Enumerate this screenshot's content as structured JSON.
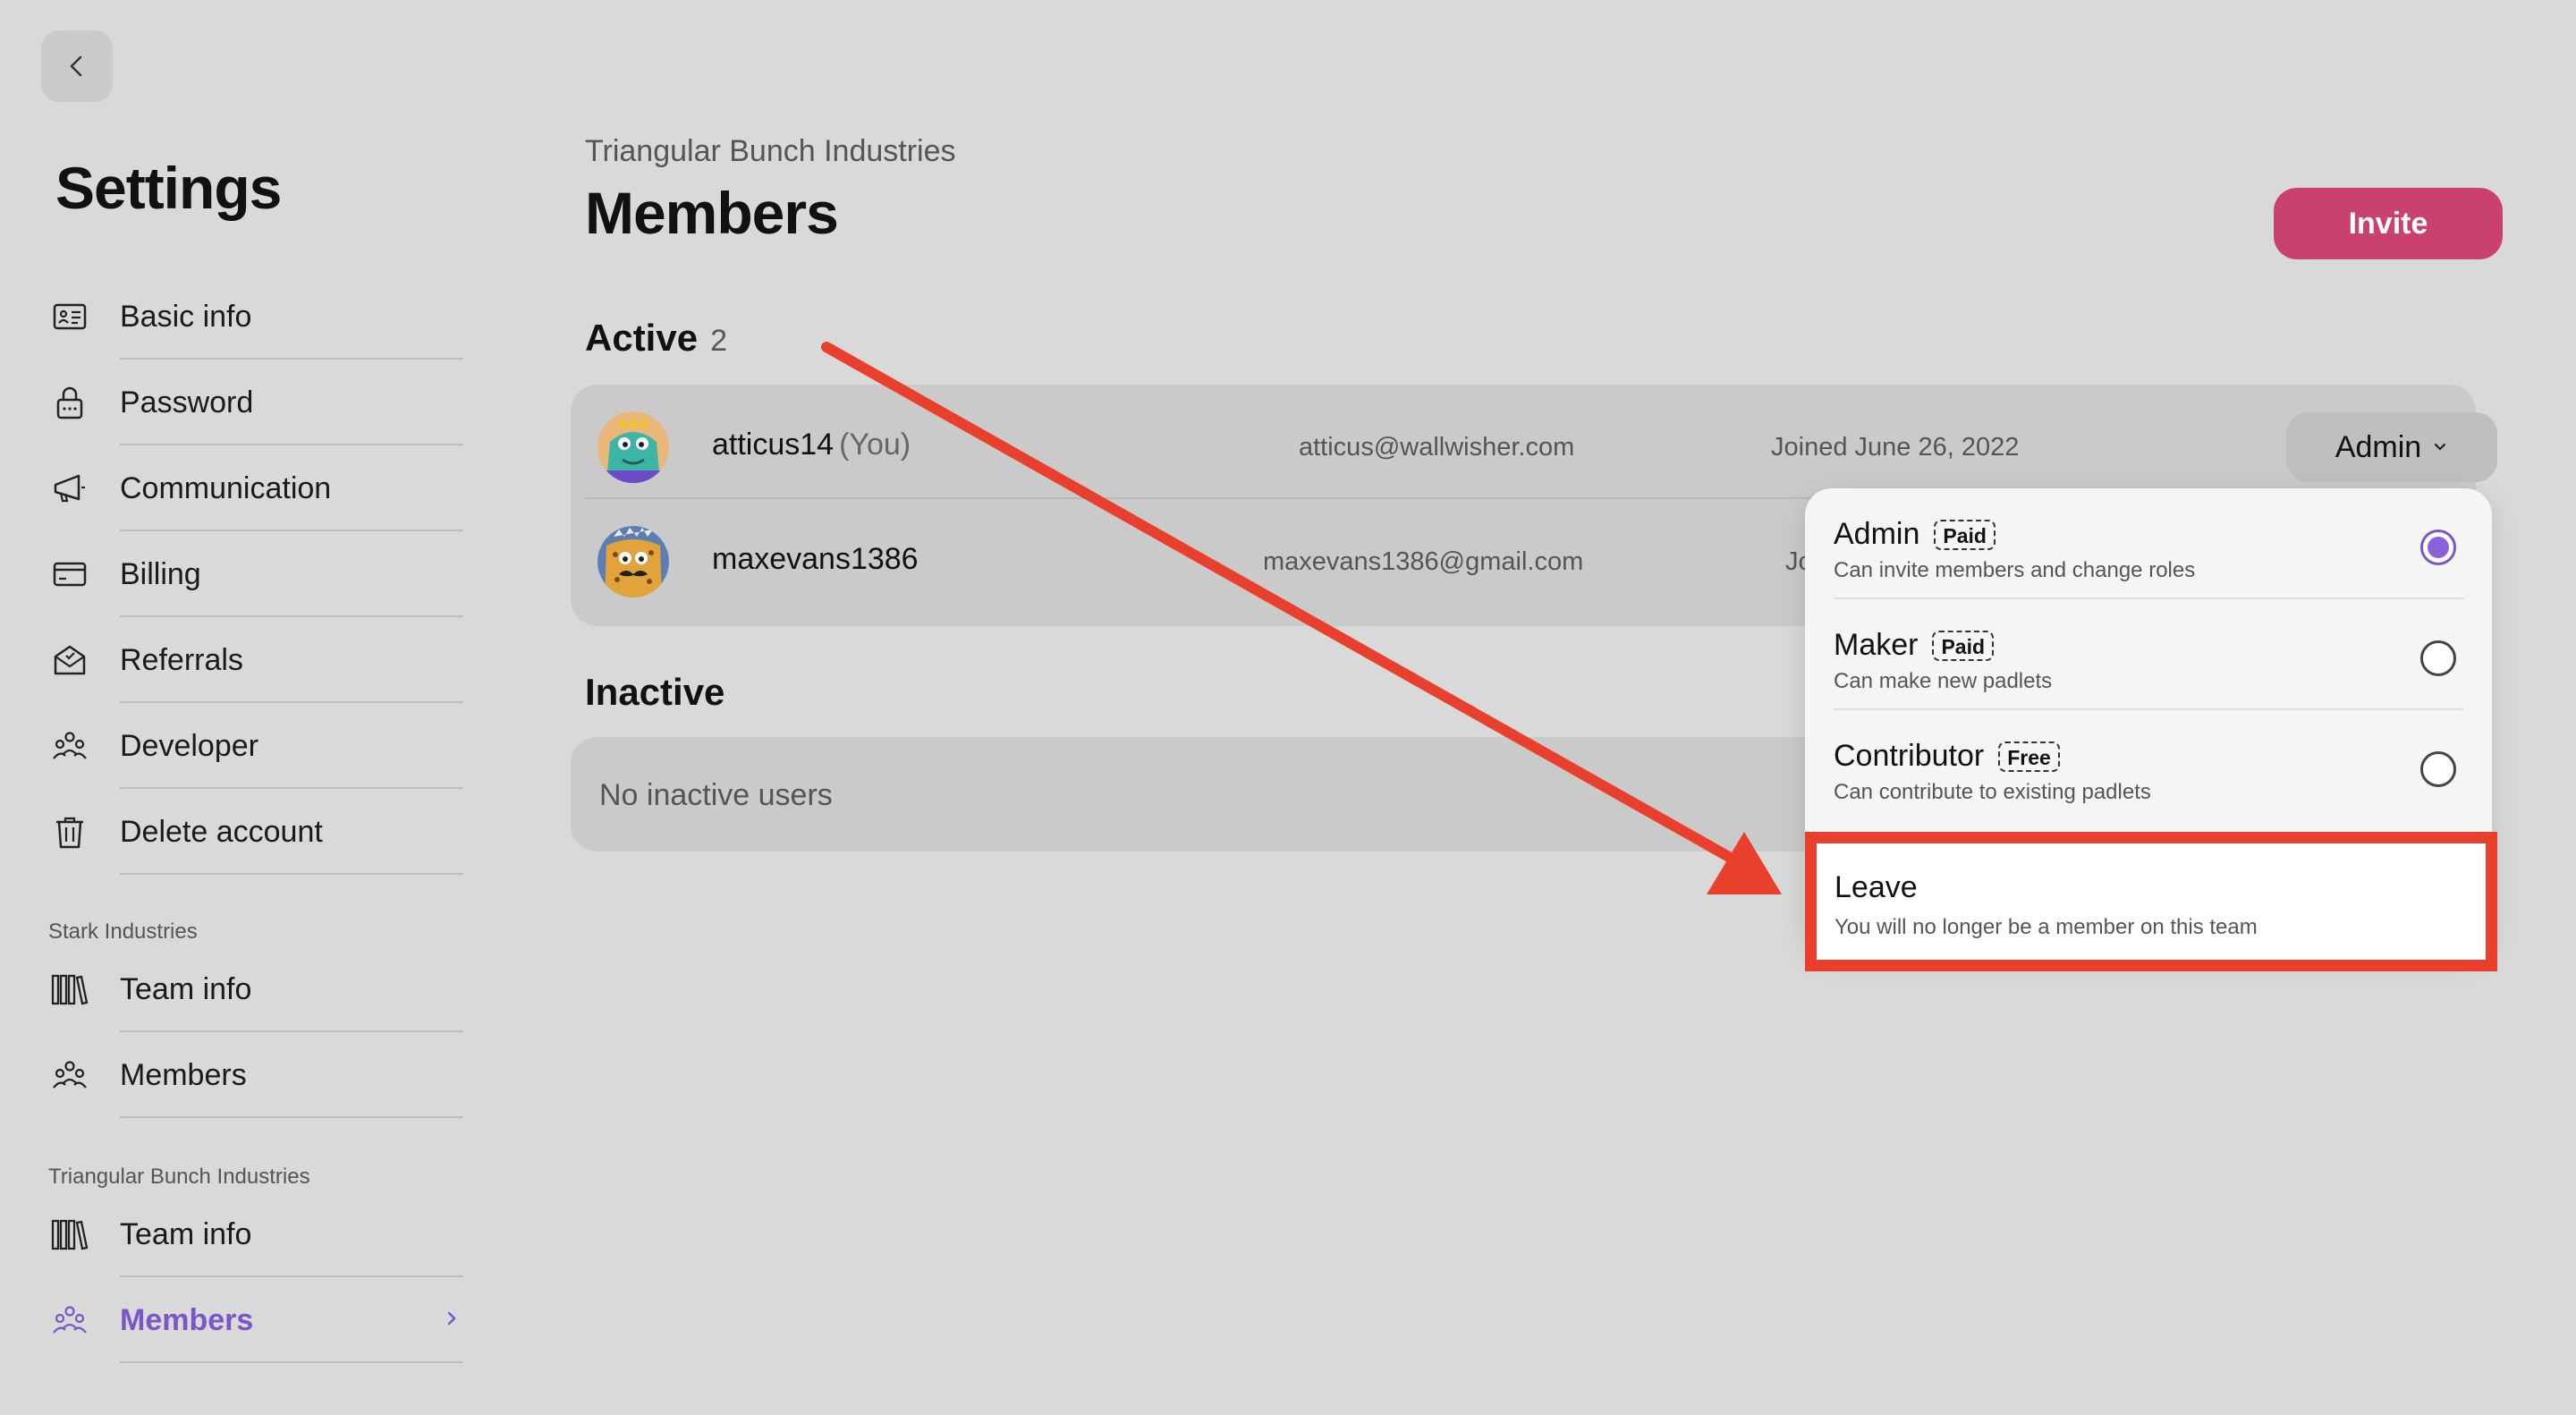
{
  "sidebar": {
    "title": "Settings",
    "account_items": [
      {
        "label": "Basic info",
        "icon": "id-card-icon"
      },
      {
        "label": "Password",
        "icon": "lock-icon"
      },
      {
        "label": "Communication",
        "icon": "megaphone-icon"
      },
      {
        "label": "Billing",
        "icon": "credit-card-icon"
      },
      {
        "label": "Referrals",
        "icon": "envelope-open-icon"
      },
      {
        "label": "Developer",
        "icon": "people-group-icon"
      },
      {
        "label": "Delete account",
        "icon": "trash-icon"
      }
    ],
    "teams": [
      {
        "name": "Stark Industries",
        "items": [
          {
            "label": "Team info",
            "icon": "books-icon"
          },
          {
            "label": "Members",
            "icon": "people-group-icon"
          }
        ]
      },
      {
        "name": "Triangular Bunch Industries",
        "items": [
          {
            "label": "Team info",
            "icon": "books-icon"
          },
          {
            "label": "Members",
            "icon": "people-group-icon",
            "active": true
          }
        ]
      }
    ]
  },
  "header": {
    "org_name": "Triangular Bunch Industries",
    "title": "Members",
    "invite_label": "Invite"
  },
  "active": {
    "heading": "Active",
    "count": "2",
    "members": [
      {
        "username": "atticus14",
        "you_label": "(You)",
        "email": "atticus@wallwisher.com",
        "joined": "Joined June 26, 2022",
        "role": "Admin"
      },
      {
        "username": "maxevans1386",
        "email": "maxevans1386@gmail.com",
        "joined": "Jo"
      }
    ]
  },
  "inactive": {
    "heading": "Inactive",
    "empty_text": "No inactive users"
  },
  "role_menu": {
    "options": [
      {
        "title": "Admin",
        "badge": "Paid",
        "desc": "Can invite members and change roles",
        "selected": true
      },
      {
        "title": "Maker",
        "badge": "Paid",
        "desc": "Can make new padlets",
        "selected": false
      },
      {
        "title": "Contributor",
        "badge": "Free",
        "desc": "Can contribute to existing padlets",
        "selected": false
      }
    ],
    "leave": {
      "title": "Leave",
      "desc": "You will no longer be a member on this team"
    }
  },
  "colors": {
    "accent": "#7b56c9",
    "invite": "#c9416c",
    "annotation": "#e8402c"
  }
}
